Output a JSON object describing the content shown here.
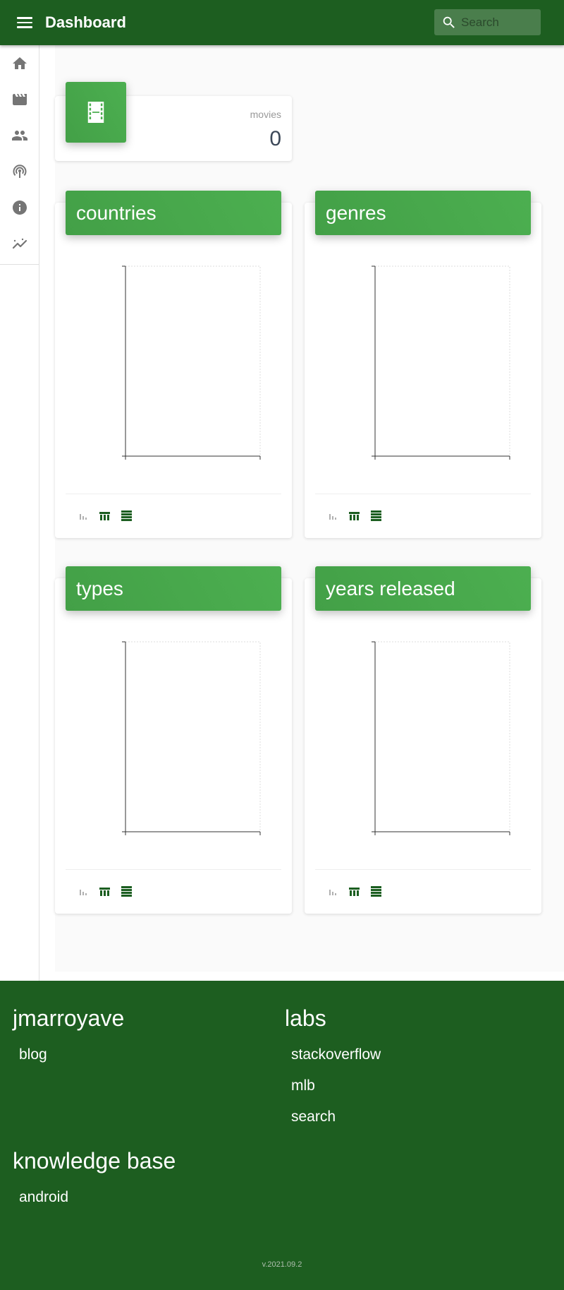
{
  "app": {
    "title": "Dashboard"
  },
  "search": {
    "placeholder": "Search"
  },
  "sidebar": {
    "items": [
      {
        "icon": "home-icon"
      },
      {
        "icon": "movie-icon"
      },
      {
        "icon": "people-icon"
      },
      {
        "icon": "podcast-icon"
      },
      {
        "icon": "info-icon"
      },
      {
        "icon": "insights-icon"
      }
    ]
  },
  "stat": {
    "label": "movies",
    "value": "0",
    "icon": "film-icon"
  },
  "charts": [
    {
      "title": "countries"
    },
    {
      "title": "genres"
    },
    {
      "title": "types"
    },
    {
      "title": "years released"
    }
  ],
  "chart_data": [
    {
      "type": "bar",
      "title": "countries",
      "categories": [],
      "values": []
    },
    {
      "type": "bar",
      "title": "genres",
      "categories": [],
      "values": []
    },
    {
      "type": "bar",
      "title": "types",
      "categories": [],
      "values": []
    },
    {
      "type": "bar",
      "title": "years released",
      "categories": [],
      "values": []
    }
  ],
  "chart_tools": [
    "bar-chart-icon",
    "table-icon",
    "list-icon"
  ],
  "colors": {
    "primary": "#1d5e20",
    "accent": "#4caf50",
    "tool_active": "#1b5e20",
    "tool_inactive": "#b0b0b0"
  },
  "footer": {
    "sections": [
      {
        "title": "jmarroyave",
        "links": [
          "blog"
        ]
      },
      {
        "title": "labs",
        "links": [
          "stackoverflow",
          "mlb",
          "search"
        ]
      },
      {
        "title": "knowledge base",
        "links": [
          "android"
        ]
      }
    ],
    "version": "v.2021.09.2"
  }
}
